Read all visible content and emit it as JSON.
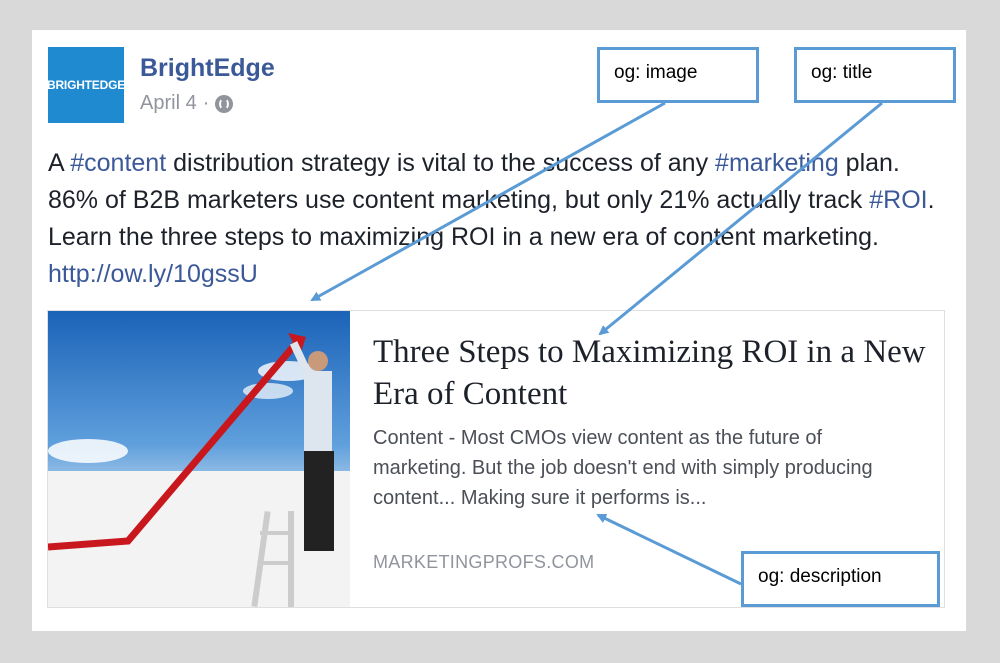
{
  "post": {
    "logo_text": "BRIGHTEDGE",
    "page_name": "BrightEdge",
    "date": "April 4",
    "separator": "·",
    "text_parts": [
      "A ",
      "#content",
      " distribution strategy is vital to the success of any ",
      "#marketing",
      " plan. 86% of B2B marketers use content marketing, but only 21% actually track ",
      "#ROI",
      ". Learn the three steps to maximizing ROI in a new era of content marketing. ",
      "http://ow.ly/10gssU"
    ]
  },
  "preview": {
    "title": "Three Steps to Maximizing ROI in a New Era of Content",
    "description": "Content - Most CMOs view content as the future of marketing. But the job doesn't end with simply producing content... Making sure it performs is...",
    "domain": "MARKETINGPROFS.COM"
  },
  "annotations": {
    "image": "og: image",
    "title": "og: title",
    "description": "og: description"
  },
  "colors": {
    "link": "#3b5998",
    "annotation_border": "#5b9bd5",
    "brand_blue": "#1f8ad0"
  },
  "icons": [
    "globe-icon",
    "chevron-down-icon"
  ]
}
